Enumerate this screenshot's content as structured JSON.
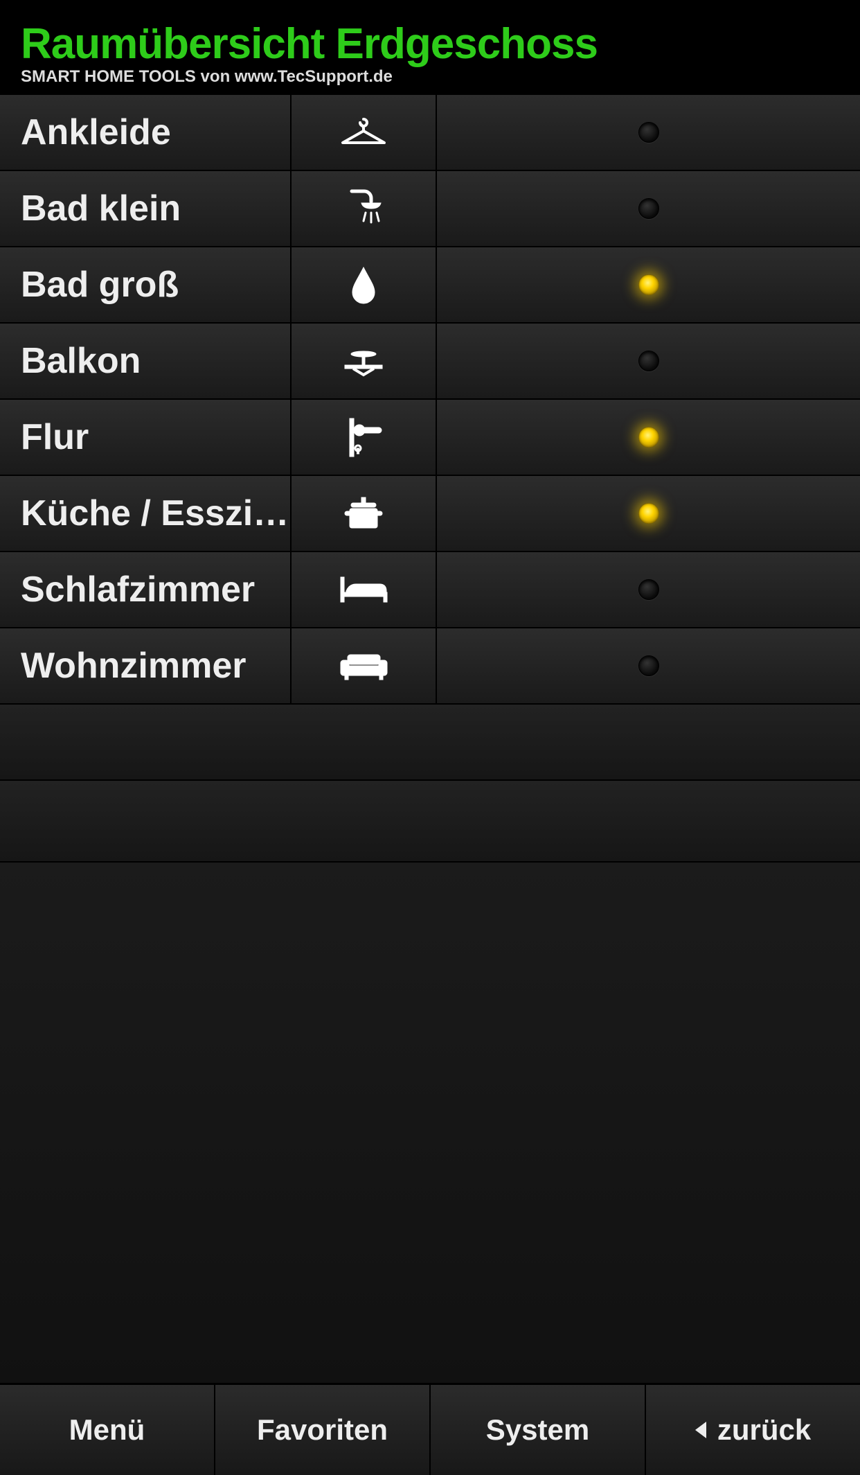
{
  "header": {
    "title": "Raumübersicht Erdgeschoss",
    "subtitle": "SMART HOME TOOLS von www.TecSupport.de"
  },
  "rooms": [
    {
      "label": "Ankleide",
      "icon": "hanger-icon",
      "on": false
    },
    {
      "label": "Bad klein",
      "icon": "shower-icon",
      "on": false
    },
    {
      "label": "Bad groß",
      "icon": "drop-icon",
      "on": true
    },
    {
      "label": "Balkon",
      "icon": "balcony-icon",
      "on": false
    },
    {
      "label": "Flur",
      "icon": "door-handle-icon",
      "on": true
    },
    {
      "label": "Küche / Esszi…",
      "icon": "pot-icon",
      "on": true
    },
    {
      "label": "Schlafzimmer",
      "icon": "bed-icon",
      "on": false
    },
    {
      "label": "Wohnzimmer",
      "icon": "sofa-icon",
      "on": false
    }
  ],
  "footer": {
    "menu": "Menü",
    "fav": "Favoriten",
    "system": "System",
    "back": "zurück"
  },
  "colors": {
    "accent": "#2ecc1a",
    "led_on": "#ffd400"
  }
}
